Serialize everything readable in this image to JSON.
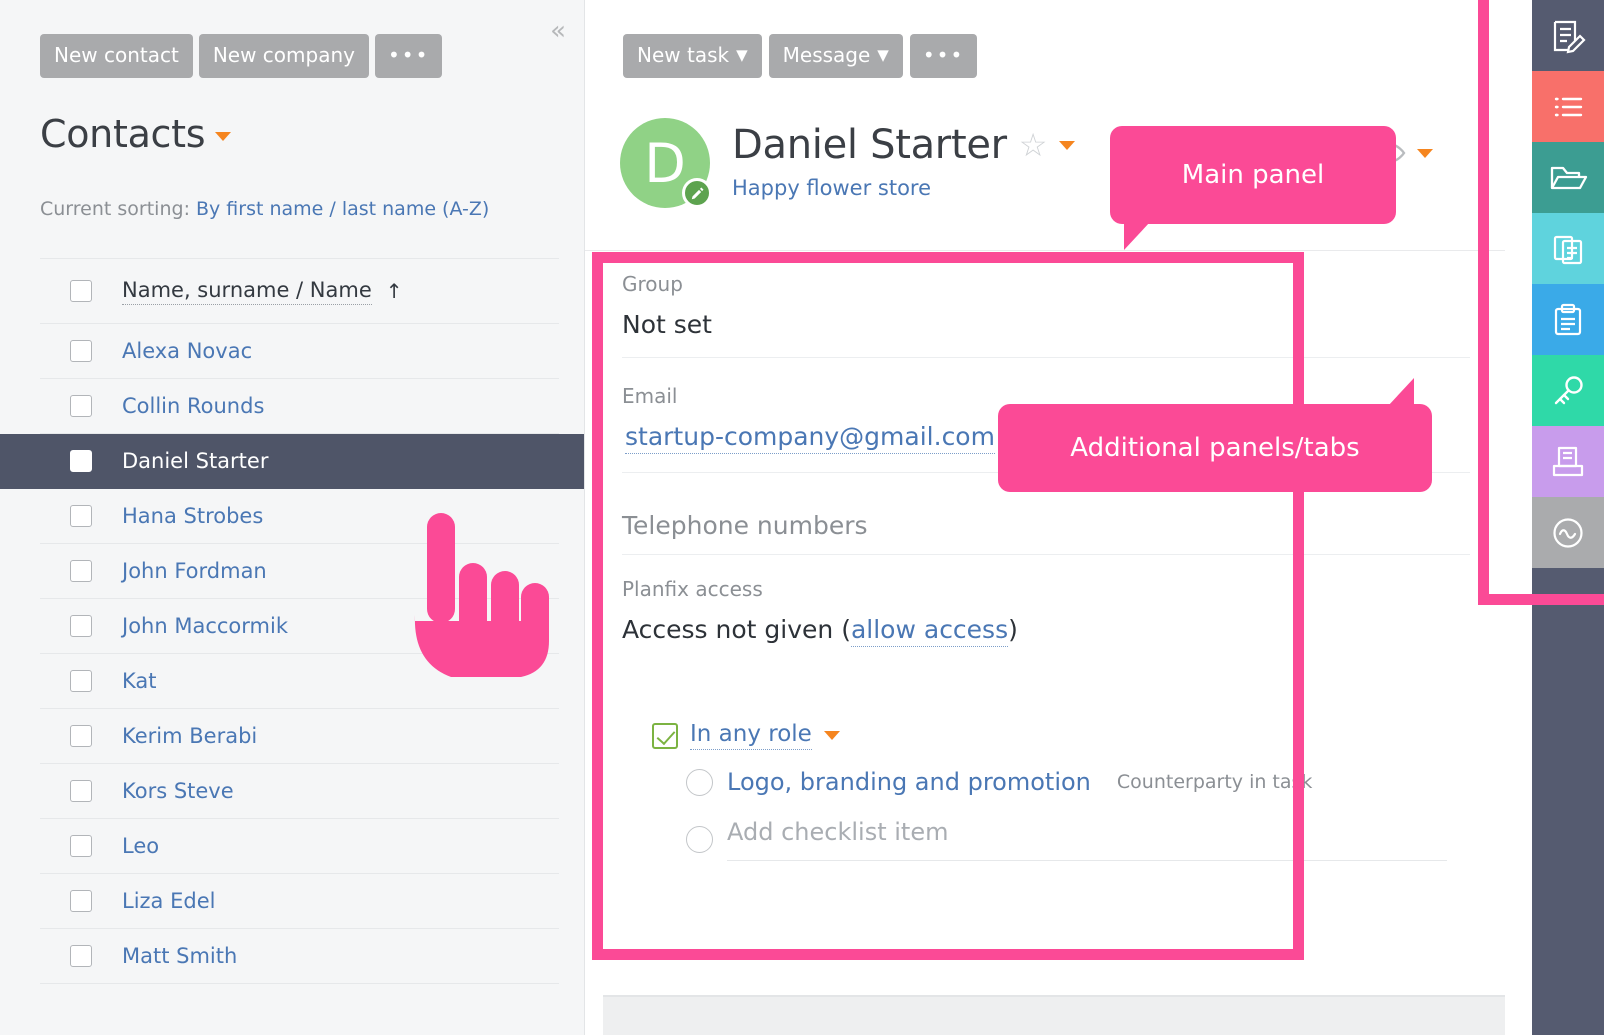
{
  "left_panel": {
    "toolbar": {
      "new_contact": "New contact",
      "new_company": "New company",
      "more": "•••"
    },
    "collapse_icon": "«",
    "title": "Contacts",
    "sorting_label": "Current sorting:",
    "sorting_value": "By first name / last name (A-Z)",
    "table_header": "Name, surname / Name",
    "sort_arrow": "↑",
    "contacts": [
      {
        "name": "Alexa Novac",
        "selected": false
      },
      {
        "name": "Collin Rounds",
        "selected": false
      },
      {
        "name": "Daniel Starter",
        "selected": true
      },
      {
        "name": "Hana Strobes",
        "selected": false
      },
      {
        "name": "John Fordman",
        "selected": false
      },
      {
        "name": "John Maccormik",
        "selected": false
      },
      {
        "name": "Kat",
        "selected": false
      },
      {
        "name": "Kerim Berabi",
        "selected": false
      },
      {
        "name": "Kors Steve",
        "selected": false
      },
      {
        "name": "Leo",
        "selected": false
      },
      {
        "name": "Liza Edel",
        "selected": false
      },
      {
        "name": "Matt Smith",
        "selected": false
      }
    ]
  },
  "main_panel": {
    "toolbar": {
      "new_task": "New task",
      "message": "Message",
      "more": "•••",
      "dropdown_caret": "▼"
    },
    "avatar_initial": "D",
    "contact_name": "Daniel Starter",
    "star_glyph": "☆",
    "company": "Happy flower store",
    "fields": [
      {
        "label": "Group",
        "value": "Not set"
      },
      {
        "label": "Email",
        "value": "startup-company@gmail.com"
      },
      {
        "label": "Telephone numbers",
        "value": ""
      },
      {
        "label": "Planfix access",
        "value": "Access not given (",
        "link": "allow access",
        "value_tail": ")"
      }
    ],
    "checklist": {
      "header": "In any role",
      "items": [
        {
          "label": "Logo, branding and promotion",
          "meta": "Counterparty in task"
        },
        {
          "label": "Add checklist item",
          "meta": ""
        }
      ]
    }
  },
  "right_rail": {
    "tabs": [
      {
        "name": "edit-note-icon",
        "color": "#555b70"
      },
      {
        "name": "list-icon",
        "color": "#f8706a"
      },
      {
        "name": "folder-icon",
        "color": "#3c9d92"
      },
      {
        "name": "copy-docs-icon",
        "color": "#5fd3dd"
      },
      {
        "name": "clipboard-icon",
        "color": "#3aaae8"
      },
      {
        "name": "key-icon",
        "color": "#2fd9a8"
      },
      {
        "name": "archive-icon",
        "color": "#c89cec"
      },
      {
        "name": "wave-circle-icon",
        "color": "#aaabad"
      }
    ]
  },
  "annotations": {
    "accent_color": "#fb4a96",
    "main_panel_label": "Main panel",
    "tabs_label": "Additional panels/tabs"
  }
}
